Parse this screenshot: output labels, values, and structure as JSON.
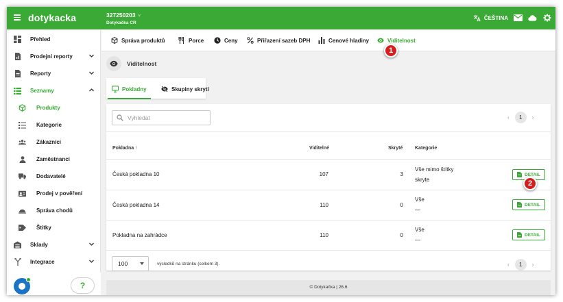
{
  "app": {
    "logo": "dotykacka",
    "account_id": "327250203",
    "account_caret": "˅",
    "account_name": "Dotykačka CR",
    "language": "ČEŠTINA",
    "brand_color": "#3aa935",
    "icons": [
      "menu-icon",
      "translate-icon",
      "mail-icon",
      "cloud-icon",
      "settings-icon"
    ]
  },
  "sidebar": {
    "items": [
      {
        "label": "Přehled",
        "icon": "dashboard-icon"
      },
      {
        "label": "Prodejní reporty",
        "icon": "report-icon"
      },
      {
        "label": "Reporty",
        "icon": "document-icon"
      },
      {
        "label": "Seznamy",
        "icon": "list-icon"
      },
      {
        "label": "Produkty",
        "icon": "cube-icon"
      },
      {
        "label": "Kategorie",
        "icon": "category-icon"
      },
      {
        "label": "Zákazníci",
        "icon": "customers-icon"
      },
      {
        "label": "Zaměstnanci",
        "icon": "person-icon"
      },
      {
        "label": "Dodavatelé",
        "icon": "truck-icon"
      },
      {
        "label": "Prodej v pověření",
        "icon": "contact-card-icon"
      },
      {
        "label": "Správa chodů",
        "icon": "courses-icon"
      },
      {
        "label": "Štítky",
        "icon": "tag-icon"
      },
      {
        "label": "Sklady",
        "icon": "warehouse-icon"
      },
      {
        "label": "Integrace",
        "icon": "integration-icon"
      }
    ],
    "help_label": "?"
  },
  "tabs": [
    {
      "label": "Správa produktů",
      "icon": "product-icon"
    },
    {
      "label": "Porce",
      "icon": "cutlery-icon"
    },
    {
      "label": "Ceny",
      "icon": "clock-icon"
    },
    {
      "label": "Přiřazení sazeb DPH",
      "icon": "percent-icon"
    },
    {
      "label": "Cenové hladiny",
      "icon": "bars-icon"
    },
    {
      "label": "Viditelnost",
      "icon": "eye-icon",
      "active": true
    }
  ],
  "annotations": {
    "badge1": "1",
    "badge2": "2",
    "color": "#d51e1e"
  },
  "page": {
    "title": "Viditelnost"
  },
  "subtabs": [
    {
      "label": "Pokladny",
      "icon": "monitor-icon",
      "active": true
    },
    {
      "label": "Skupiny skrytí",
      "icon": "eye-off-icon"
    }
  ],
  "search": {
    "placeholder": "Vyhledat"
  },
  "pagination": {
    "prev": "‹",
    "page": "1",
    "next": "›"
  },
  "table": {
    "headers": {
      "name": "Pokladna",
      "sort": "↑",
      "visible": "Viditelné",
      "hidden": "Skryté",
      "category": "Kategorie"
    },
    "rows": [
      {
        "name": "Česká pokladna 10",
        "visible": "107",
        "hidden": "3",
        "cat1": "Vše mimo štítky",
        "cat2": "skryte",
        "action": "DETAIL"
      },
      {
        "name": "Česká pokladna 14",
        "visible": "110",
        "hidden": "0",
        "cat1": "Vše",
        "cat2": "—",
        "action": "DETAIL"
      },
      {
        "name": "Pokladna na zahrádce",
        "visible": "110",
        "hidden": "0",
        "cat1": "Vše",
        "cat2": "—",
        "action": "DETAIL"
      }
    ]
  },
  "per_page": {
    "value": "100",
    "results_text": "výsledků na stránku (celkem 3)."
  },
  "footer": {
    "brand": "© Dotykačka",
    "separator": "|",
    "version": "26.6"
  }
}
